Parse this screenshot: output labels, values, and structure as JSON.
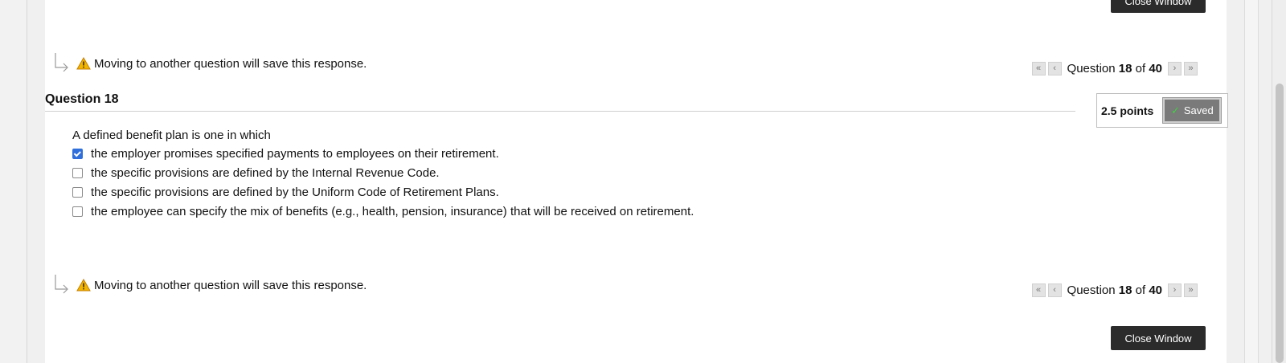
{
  "top": {
    "close_button_label": "Close Window"
  },
  "warning": {
    "text": "Moving to another question will save this response."
  },
  "navigation": {
    "label_prefix": "Question",
    "current": "18",
    "of_label": "of",
    "total": "40"
  },
  "question": {
    "title": "Question 18",
    "points": "2.5 points",
    "saved_label": "Saved",
    "stem": "A defined benefit plan is one in which",
    "options": [
      {
        "label": "the employer promises specified payments to employees on their retirement.",
        "checked": true
      },
      {
        "label": "the specific provisions are defined by the Internal Revenue Code.",
        "checked": false
      },
      {
        "label": "the specific provisions are defined by the Uniform Code of Retirement Plans.",
        "checked": false
      },
      {
        "label": "the employee can specify the mix of benefits (e.g., health, pension, insurance) that will be received on retirement.",
        "checked": false
      }
    ]
  },
  "bottom": {
    "close_button_label": "Close Window"
  },
  "icons": {
    "warning": "warning-triangle-icon",
    "arrow": "reply-arrow-icon",
    "first": "double-chevron-left-icon",
    "prev": "chevron-left-icon",
    "next": "chevron-right-icon",
    "last": "double-chevron-right-icon",
    "check": "checkmark-icon"
  },
  "colors": {
    "button_dark": "#2b2b2b",
    "checkbox_checked": "#2f6fdc",
    "saved_badge": "#7a7a7a",
    "saved_check": "#3fd43f",
    "warning_yellow": "#f2b600"
  }
}
